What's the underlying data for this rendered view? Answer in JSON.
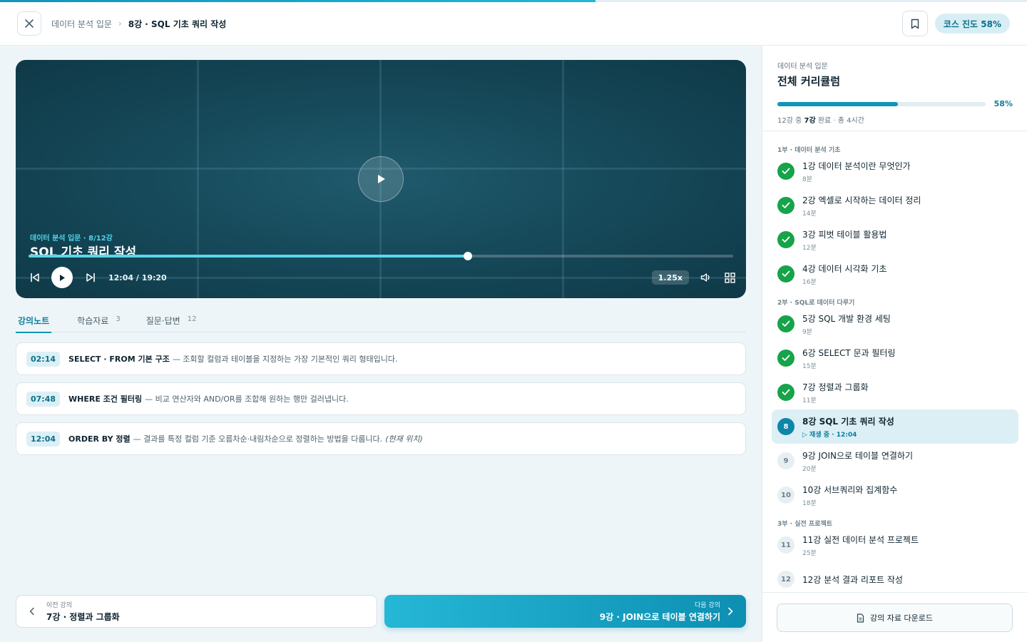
{
  "course_progress": {
    "percent": 58
  },
  "header": {
    "breadcrumb_parent": "데이터 분석 입문",
    "breadcrumb_current": "8강 · SQL 기초 쿼리 작성",
    "progress_label": "코스 진도 58%"
  },
  "video": {
    "kicker": "데이터 분석 입문 · 8/12강",
    "title": "SQL 기초 쿼리 작성",
    "time": "12:04 / 19:20",
    "played_fraction": 0.623,
    "speed": "1.25x"
  },
  "tabs": [
    {
      "label": "강의노트",
      "count": "",
      "active": true
    },
    {
      "label": "학습자료",
      "count": "3",
      "active": false
    },
    {
      "label": "질문·답변",
      "count": "12",
      "active": false
    }
  ],
  "notes": [
    {
      "time": "02:14",
      "title": "SELECT · FROM 기본 구조",
      "body": "— 조회할 컬럼과 테이블을 지정하는 가장 기본적인 쿼리 형태입니다.",
      "extra": ""
    },
    {
      "time": "07:48",
      "title": "WHERE 조건 필터링",
      "body": "— 비교 연산자와 AND/OR를 조합해 원하는 행만 걸러냅니다.",
      "extra": ""
    },
    {
      "time": "12:04",
      "title": "ORDER BY 정렬",
      "body": "— 결과를 특정 컬럼 기준 오름차순·내림차순으로 정렬하는 방법을 다룹니다.",
      "extra": "(현재 위치)"
    }
  ],
  "nav": {
    "prev_small": "이전 강의",
    "prev_title": "7강 · 정렬과 그룹화",
    "next_small": "다음 강의",
    "next_title": "9강 · JOIN으로 테이블 연결하기"
  },
  "sidebar": {
    "course": "데이터 분석 입문",
    "title": "전체 커리큘럼",
    "percent_label": "58%",
    "percent": 58,
    "summary_prefix": "12강 중 ",
    "summary_done": "7강",
    "summary_suffix": " 완료 · 총 4시간",
    "sections": [
      {
        "label": "1부 · 데이터 분석 기초",
        "lessons": [
          {
            "num": "1",
            "title": "1강 데이터 분석이란 무엇인가",
            "sub": "8분",
            "state": "done"
          },
          {
            "num": "2",
            "title": "2강 엑셀로 시작하는 데이터 정리",
            "sub": "14분",
            "state": "done"
          },
          {
            "num": "3",
            "title": "3강 피벗 테이블 활용법",
            "sub": "12분",
            "state": "done"
          },
          {
            "num": "4",
            "title": "4강 데이터 시각화 기초",
            "sub": "16분",
            "state": "done"
          }
        ]
      },
      {
        "label": "2부 · SQL로 데이터 다루기",
        "lessons": [
          {
            "num": "5",
            "title": "5강 SQL 개발 환경 세팅",
            "sub": "9분",
            "state": "done"
          },
          {
            "num": "6",
            "title": "6강 SELECT 문과 필터링",
            "sub": "15분",
            "state": "done"
          },
          {
            "num": "7",
            "title": "7강 정렬과 그룹화",
            "sub": "11분",
            "state": "done"
          },
          {
            "num": "8",
            "title": "8강 SQL 기초 쿼리 작성",
            "sub": "▷ 재생 중 · 12:04",
            "state": "current"
          },
          {
            "num": "9",
            "title": "9강 JOIN으로 테이블 연결하기",
            "sub": "20분",
            "state": "todo"
          },
          {
            "num": "10",
            "title": "10강 서브쿼리와 집계함수",
            "sub": "18분",
            "state": "todo"
          }
        ]
      },
      {
        "label": "3부 · 실전 프로젝트",
        "lessons": [
          {
            "num": "11",
            "title": "11강 실전 데이터 분석 프로젝트",
            "sub": "25분",
            "state": "todo"
          },
          {
            "num": "12",
            "title": "12강 분석 결과 리포트 작성",
            "sub": "",
            "state": "todo"
          }
        ]
      }
    ],
    "download_label": "강의 자료 다운로드"
  },
  "colors": {
    "accent": "#0f96b8",
    "done": "#17a34a",
    "video_bg": "#164a5b",
    "seek": "#5ad7ea"
  },
  "icons": [
    "close-icon",
    "chevron-right-icon",
    "bookmark-icon",
    "play-icon",
    "skip-back-icon",
    "skip-forward-icon",
    "volume-icon",
    "grid-icon",
    "check-icon",
    "chevron-left-icon",
    "file-icon"
  ]
}
